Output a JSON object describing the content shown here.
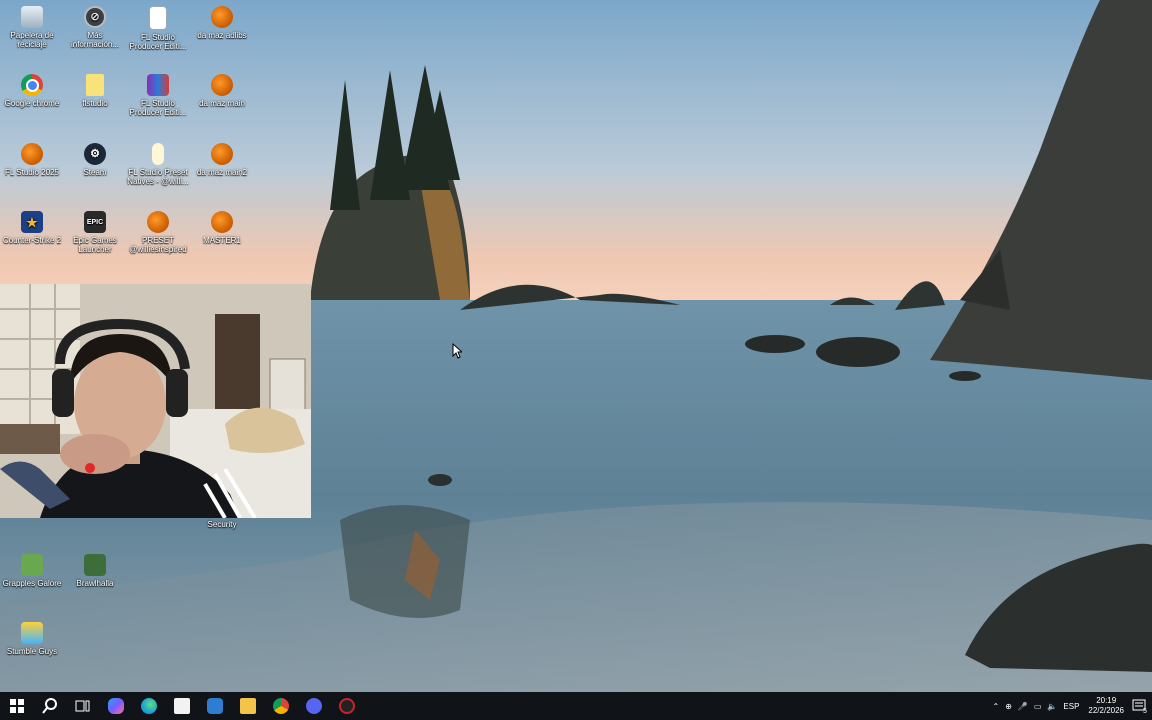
{
  "desktop": {
    "icons": [
      {
        "label": "Papelera de reciclaje",
        "icon": "recycle-bin-icon"
      },
      {
        "label": "Más información...",
        "icon": "info-icon"
      },
      {
        "label": "FL Studio Producer Editi...",
        "icon": "fl-file-icon"
      },
      {
        "label": "da maz adlibs",
        "icon": "fl-studio-icon"
      },
      {
        "label": "Google chrome",
        "icon": "chrome-icon"
      },
      {
        "label": "flstudio",
        "icon": "folder-icon"
      },
      {
        "label": "FL Studio Producer Editi...",
        "icon": "winrar-icon"
      },
      {
        "label": "da maz main",
        "icon": "fl-studio-icon"
      },
      {
        "label": "FL Studio 2025",
        "icon": "fl-studio-icon"
      },
      {
        "label": "Steam",
        "icon": "steam-icon"
      },
      {
        "label": "FL Studio Preset Natives - @willi...",
        "icon": "fl-preset-icon"
      },
      {
        "label": "da maz main2",
        "icon": "fl-studio-icon"
      },
      {
        "label": "Counter-Strike 2",
        "icon": "cs2-icon"
      },
      {
        "label": "Epic Games Launcher",
        "icon": "epic-games-icon"
      },
      {
        "label": "PRESET @williesinspired",
        "icon": "fl-studio-icon"
      },
      {
        "label": "MASTER1",
        "icon": "fl-studio-icon"
      },
      {
        "label": "Security",
        "icon": "security-icon"
      },
      {
        "label": "Grapples Galore",
        "icon": "grapples-galore-icon"
      },
      {
        "label": "Brawlhalla",
        "icon": "brawlhalla-icon"
      },
      {
        "label": "Stumble Guys",
        "icon": "stumble-guys-icon"
      }
    ]
  },
  "taskbar": {
    "apps": [
      {
        "icon": "copilot-icon",
        "color": "#7a5cff"
      },
      {
        "icon": "edge-icon",
        "color": "#1aa0d8"
      },
      {
        "icon": "microsoft-store-icon",
        "color": "#f2f2f2"
      },
      {
        "icon": "mail-icon",
        "color": "#2d7dd2"
      },
      {
        "icon": "file-explorer-icon",
        "color": "#f3c44a"
      },
      {
        "icon": "chrome-icon",
        "color": "#db4437"
      },
      {
        "icon": "discord-icon",
        "color": "#5865f2"
      },
      {
        "icon": "obs-icon",
        "color": "#c8222a"
      }
    ],
    "tray": {
      "language": "ESP",
      "time": "20:19",
      "date": "22/2/2026",
      "notification_count": "5"
    }
  }
}
